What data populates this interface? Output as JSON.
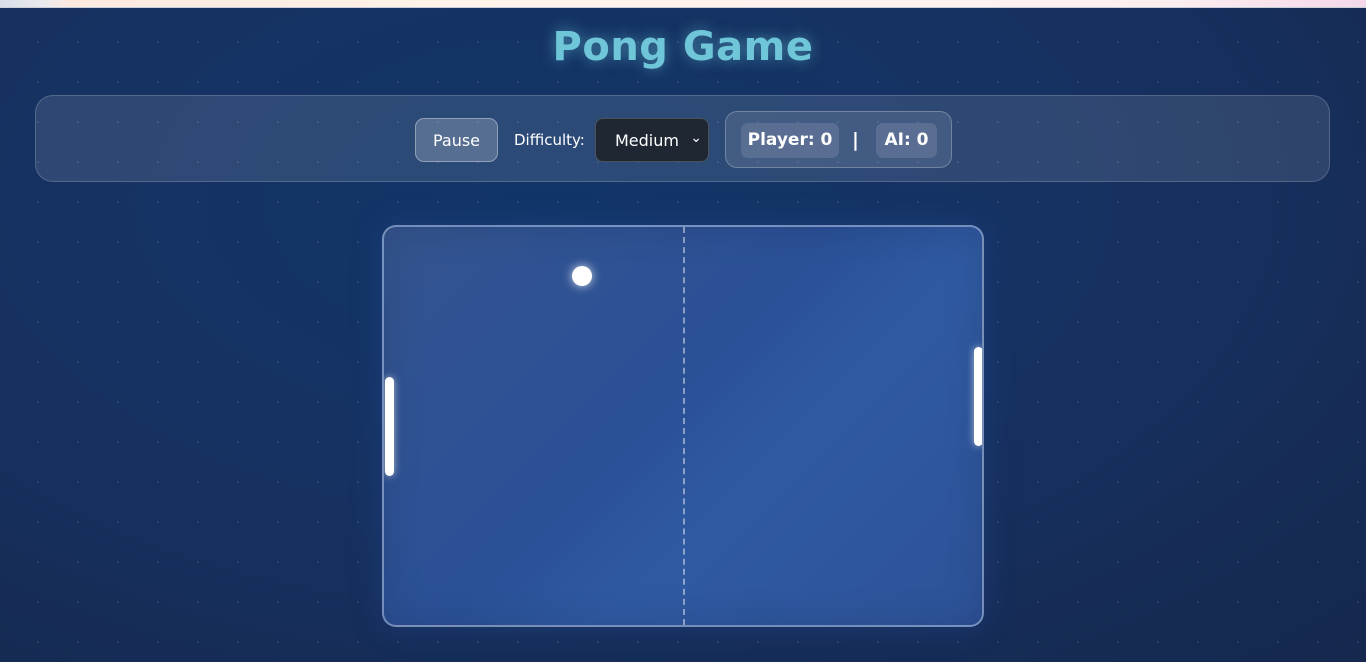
{
  "app": {
    "title": "Pong Game"
  },
  "controls": {
    "pause_label": "Pause",
    "difficulty_label": "Difficulty:",
    "difficulty_value": "Medium"
  },
  "score": {
    "player_label": "Player: 0",
    "separator": "|",
    "ai_label": "AI: 0",
    "player": 0,
    "ai": 0
  },
  "icons": {
    "dropdown": "chevron-down-icon"
  },
  "colors": {
    "title": "#6ec6d8",
    "background": "#163262",
    "board": "#2a5096",
    "paddle": "#ffffff",
    "ball": "#ffffff"
  }
}
